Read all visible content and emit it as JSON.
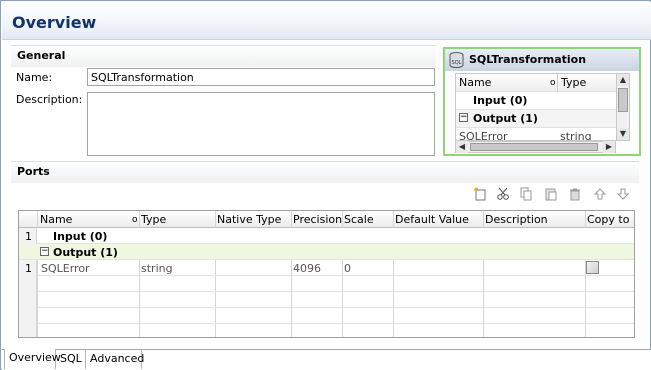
{
  "header": {
    "title": "Overview"
  },
  "general": {
    "section_label": "General",
    "name_label": "Name:",
    "name_value": "SQLTransformation",
    "description_label": "Description:",
    "description_value": ""
  },
  "transformation_panel": {
    "title": "SQLTransformation",
    "icon": "sql-transformation-icon",
    "col_name": "Name",
    "col_type": "Type",
    "input_group": "Input (0)",
    "output_group": "Output (1)",
    "rows": [
      {
        "name": "SQLError",
        "type": "string"
      }
    ]
  },
  "ports": {
    "section_label": "Ports",
    "toolbar_icons": [
      "new-port-icon",
      "cut-icon",
      "copy-icon",
      "paste-icon",
      "delete-icon",
      "move-up-icon",
      "move-down-icon"
    ],
    "columns": [
      "Name",
      "Type",
      "Native Type",
      "Precision",
      "Scale",
      "Default Value",
      "Description",
      "Copy to ..."
    ],
    "input_group": {
      "row_number": "1",
      "label": "Input (0)"
    },
    "output_group": {
      "label": "Output (1)"
    },
    "rows": [
      {
        "row_number": "1",
        "name": "SQLError",
        "type": "string",
        "native_type": "",
        "precision": "4096",
        "scale": "0",
        "default_value": "",
        "description": ""
      }
    ]
  },
  "tabs": [
    "Overview",
    "SQL",
    "Advanced"
  ],
  "colors": {
    "title": "#12326b",
    "highlight_green": "#8fd37c",
    "output_row": "#eef8e0"
  }
}
